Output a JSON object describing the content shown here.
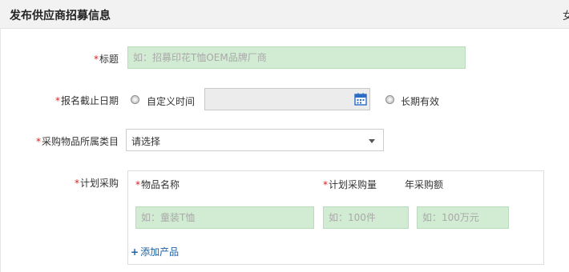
{
  "header": {
    "title": "发布供应商招募信息",
    "right_text": "女"
  },
  "form": {
    "required_mark": "*",
    "title_field": {
      "label": "标题",
      "placeholder": "如：招募印花T恤OEM品牌厂商"
    },
    "deadline": {
      "label": "报名截止日期",
      "option_custom": "自定义时间",
      "date_value": "",
      "option_long_term": "长期有效"
    },
    "category": {
      "label": "采购物品所属类目",
      "selected": "请选择"
    },
    "plan": {
      "label": "计划采购",
      "columns": {
        "name": "物品名称",
        "quantity": "计划采购量",
        "amount": "年采购额"
      },
      "row": {
        "name_placeholder": "如：童装T恤",
        "quantity_placeholder": "如：100件",
        "amount_placeholder": "如：100万元"
      },
      "add_product": "添加产品"
    }
  },
  "colors": {
    "input_green": "#d2ebd3",
    "required_red": "#e02020",
    "link_blue": "#1a5fa8"
  }
}
